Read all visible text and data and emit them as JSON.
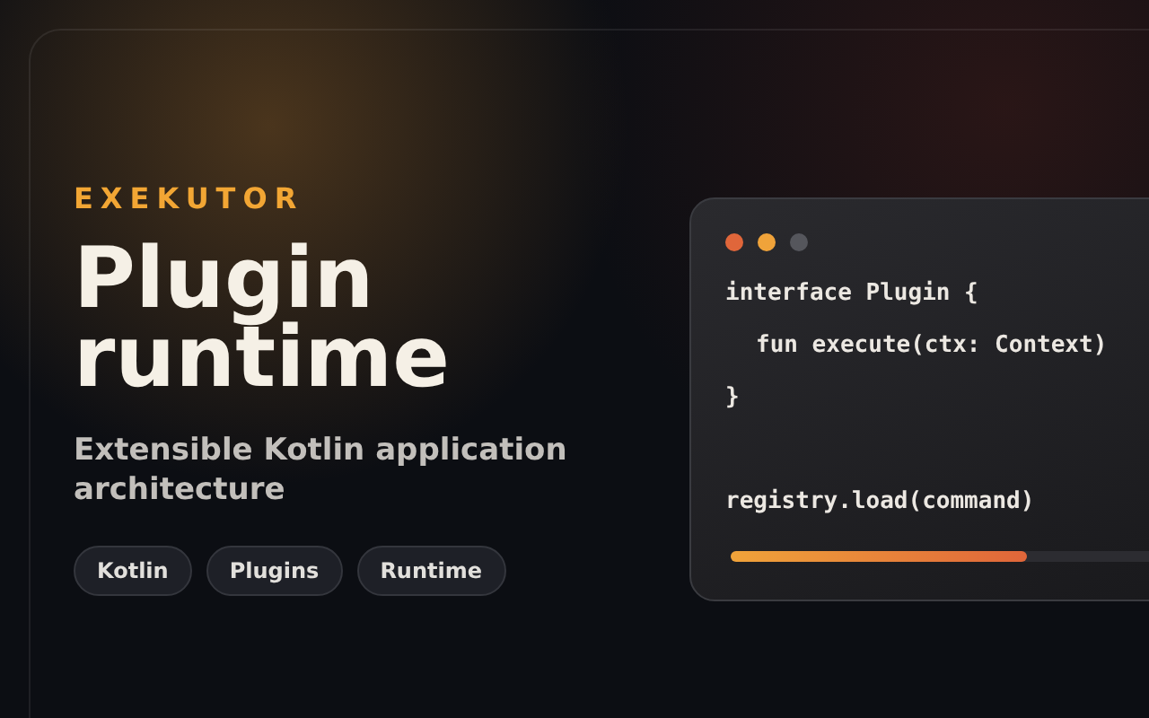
{
  "brand": "EXEKUTOR",
  "title": [
    "Plugin",
    "runtime"
  ],
  "subtitle": "Extensible Kotlin application architecture",
  "tags": [
    "Kotlin",
    "Plugins",
    "Runtime"
  ],
  "code_window": {
    "blocks": [
      {
        "lines": [
          {
            "text": "interface Plugin {",
            "children": [
              {
                "text": "fun execute(ctx: Context)"
              }
            ]
          },
          {
            "text": "}"
          }
        ]
      },
      {
        "lines": [
          {
            "text": "registry.load(command)"
          }
        ]
      }
    ],
    "progress": {
      "level": 0.7
    }
  }
}
